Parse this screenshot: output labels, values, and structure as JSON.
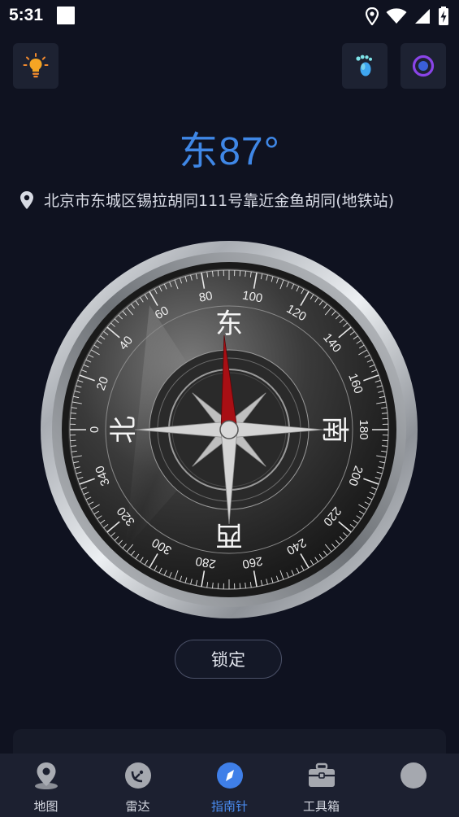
{
  "status_bar": {
    "time": "5:31"
  },
  "toolbar": {
    "flashlight_icon": "lightbulb-icon",
    "footprint_icon": "footprint-icon",
    "record_icon": "record-icon"
  },
  "heading": {
    "direction_reading": "东87°"
  },
  "location": {
    "address": "北京市东城区锡拉胡同111号靠近金鱼胡同(地铁站)"
  },
  "compass": {
    "heading_degrees": 87,
    "scale_labels": [
      "0",
      "20",
      "40",
      "60",
      "80",
      "100",
      "120",
      "140",
      "160",
      "180",
      "200",
      "220",
      "240",
      "260",
      "280",
      "300",
      "320",
      "340"
    ],
    "cardinals": {
      "north": "北",
      "east": "东",
      "south": "南",
      "west": "西"
    },
    "needle_color": "#a80f14"
  },
  "lock_button": {
    "label": "锁定"
  },
  "bottom_nav": {
    "active_color": "#4a8cf0",
    "items": [
      {
        "label": "地图",
        "icon": "map-pin-icon"
      },
      {
        "label": "雷达",
        "icon": "radar-icon"
      },
      {
        "label": "指南针",
        "icon": "compass-icon"
      },
      {
        "label": "工具箱",
        "icon": "toolbox-icon"
      },
      {
        "label": "",
        "icon": "profile-icon"
      }
    ]
  }
}
